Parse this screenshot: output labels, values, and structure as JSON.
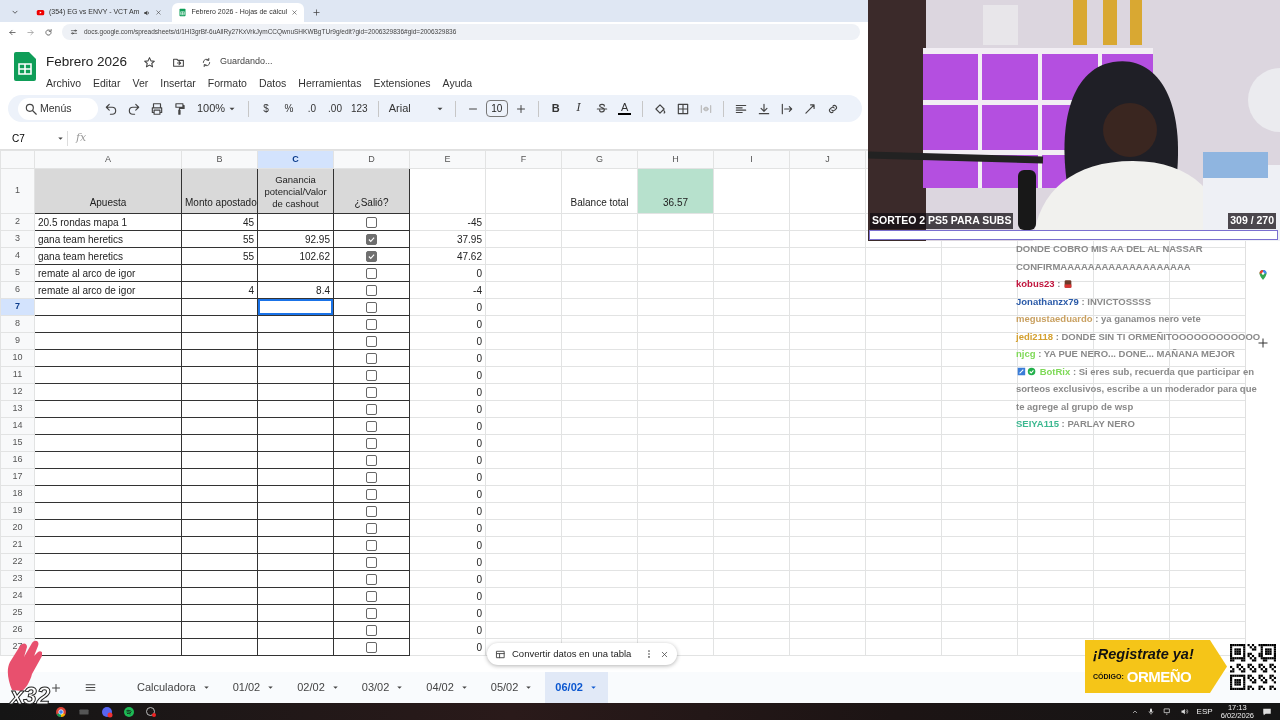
{
  "browser": {
    "tabs": [
      {
        "title": "(354) EG vs ENVY - VCT Am",
        "selected": false,
        "kind": "video"
      },
      {
        "title": "Febrero 2026 - Hojas de cálcul",
        "selected": true,
        "kind": "sheet"
      }
    ],
    "url": "docs.google.com/spreadsheets/d/1HI3grBf-6uAllRy27KxVrkJymCCQwnuSHKWBgTUr9g/edit?gid=2006329836#gid=2006329836"
  },
  "doc": {
    "title": "Febrero 2026",
    "status": "Guardando...",
    "menus": [
      "Archivo",
      "Editar",
      "Ver",
      "Insertar",
      "Formato",
      "Datos",
      "Herramientas",
      "Extensiones",
      "Ayuda"
    ]
  },
  "toolbar": {
    "search": "Menús",
    "zoom": "100%",
    "currency": "$",
    "percent": "%",
    "dec_less": ".0",
    "dec_more": ".00",
    "number_format": "123",
    "font": "Arial",
    "font_size": "10",
    "bold": "B",
    "italic": "I",
    "text_color": "A"
  },
  "formula_bar": {
    "cell_ref": "C7",
    "fx": "fx"
  },
  "grid": {
    "columns": [
      {
        "label": "A",
        "selected": false
      },
      {
        "label": "B",
        "selected": false
      },
      {
        "label": "C",
        "selected": true
      },
      {
        "label": "D",
        "selected": false
      },
      {
        "label": "E",
        "selected": false
      },
      {
        "label": "F",
        "selected": false
      },
      {
        "label": "G",
        "selected": false
      },
      {
        "label": "H",
        "selected": false
      },
      {
        "label": "I",
        "selected": false
      },
      {
        "label": "J",
        "selected": false
      }
    ],
    "header_row": {
      "num": "1",
      "selected": false,
      "a": "Apuesta",
      "b": "Monto apostado",
      "c": "Ganancia potencial/Valor de cashout",
      "d": "¿Salió?",
      "g": "Balance total",
      "h": "36.57"
    },
    "rows": [
      {
        "num": "2",
        "selected": false,
        "a": "20.5 rondas mapa 1",
        "b": "45",
        "checked": false,
        "e": "-45"
      },
      {
        "num": "3",
        "selected": false,
        "a": "gana team heretics",
        "b": "55",
        "c": "92.95",
        "checked": true,
        "e": "37.95"
      },
      {
        "num": "4",
        "selected": false,
        "a": "gana team heretics",
        "b": "55",
        "c": "102.62",
        "checked": true,
        "e": "47.62"
      },
      {
        "num": "5",
        "selected": false,
        "a": "remate al arco de igor",
        "checked": false,
        "e": "0"
      },
      {
        "num": "6",
        "selected": false,
        "a": "remate al arco de igor",
        "b": "4",
        "c": "8.4",
        "checked": false,
        "e": "-4"
      },
      {
        "num": "7",
        "selected": true,
        "checked": false,
        "e": "0"
      },
      {
        "num": "8",
        "selected": false,
        "checked": false,
        "e": "0"
      },
      {
        "num": "9",
        "selected": false,
        "checked": false,
        "e": "0"
      },
      {
        "num": "10",
        "selected": false,
        "checked": false,
        "e": "0"
      },
      {
        "num": "11",
        "selected": false,
        "checked": false,
        "e": "0"
      },
      {
        "num": "12",
        "selected": false,
        "checked": false,
        "e": "0"
      },
      {
        "num": "13",
        "selected": false,
        "checked": false,
        "e": "0"
      },
      {
        "num": "14",
        "selected": false,
        "checked": false,
        "e": "0"
      },
      {
        "num": "15",
        "selected": false,
        "checked": false,
        "e": "0"
      },
      {
        "num": "16",
        "selected": false,
        "checked": false,
        "e": "0"
      },
      {
        "num": "17",
        "selected": false,
        "checked": false,
        "e": "0"
      },
      {
        "num": "18",
        "selected": false,
        "checked": false,
        "e": "0"
      },
      {
        "num": "19",
        "selected": false,
        "checked": false,
        "e": "0"
      },
      {
        "num": "20",
        "selected": false,
        "checked": false,
        "e": "0"
      },
      {
        "num": "21",
        "selected": false,
        "checked": false,
        "e": "0"
      },
      {
        "num": "22",
        "selected": false,
        "checked": false,
        "e": "0"
      },
      {
        "num": "23",
        "selected": false,
        "checked": false,
        "e": "0"
      },
      {
        "num": "24",
        "selected": false,
        "checked": false,
        "e": "0"
      },
      {
        "num": "25",
        "selected": false,
        "checked": false,
        "e": "0"
      },
      {
        "num": "26",
        "selected": false,
        "checked": false,
        "e": "0"
      },
      {
        "num": "27",
        "selected": false,
        "checked": false,
        "e": "0"
      }
    ]
  },
  "sheet_tabs": [
    {
      "label": "Calculadora",
      "selected": false
    },
    {
      "label": "01/02",
      "selected": false
    },
    {
      "label": "02/02",
      "selected": false
    },
    {
      "label": "03/02",
      "selected": false
    },
    {
      "label": "04/02",
      "selected": false
    },
    {
      "label": "05/02",
      "selected": false
    },
    {
      "label": "06/02",
      "selected": true
    }
  ],
  "toast": {
    "text": "Convertir datos en una tabla"
  },
  "webcam": {
    "kind": "picture",
    "banner": "SORTEO 2 PS5 PARA SUBS",
    "goal": "309 / 270",
    "level": 1
  },
  "chat": [
    {
      "text": "DONDE COBRO MIS AA DEL AL NASSAR CONFIRMAAAAAAAAAAAAAAAAAAA"
    },
    {
      "user": "kobus23",
      "color": "#c0143c",
      "text": ":",
      "emote": true
    },
    {
      "user": "Jonathanzx79",
      "color": "#2a5aa8",
      "text": ": INVICTOSSSS"
    },
    {
      "user": "megustaeduardo",
      "color": "#c9a060",
      "text": ": ya ganamos nero vete"
    },
    {
      "user": "jedi2118",
      "color": "#d4a030",
      "text": ": DONDE SIN TI ORMEÑITOOOOOOOOOOOO"
    },
    {
      "user": "njcg",
      "color": "#7ed957",
      "text": ": YA PUE NERO... DONE... MAÑANA MEJOR"
    },
    {
      "user": "BotRix",
      "color": "#7ed957",
      "badges": true,
      "text": ": Si eres sub, recuerda que participar en sorteos exclusivos, escribe a un moderador para que te agrege al grupo de wsp"
    },
    {
      "user": "SEIYA115",
      "color": "#3cb890",
      "text": ": PARLAY NERO"
    }
  ],
  "ad": {
    "headline": "¡Registrate ya!",
    "code_label": "CÓDIGO:",
    "code": "ORMEÑO"
  },
  "sticker": {
    "text": "x32"
  },
  "taskbar": {
    "language": "ESP",
    "time": "17:13",
    "date": "6/02/2026"
  }
}
